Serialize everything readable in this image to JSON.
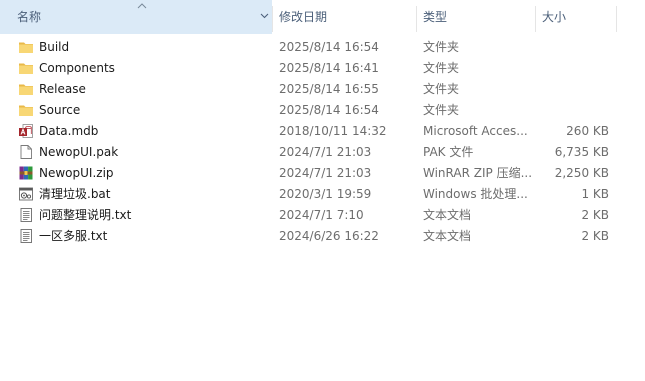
{
  "columns": {
    "name": "名称",
    "date": "修改日期",
    "type": "类型",
    "size": "大小"
  },
  "files": [
    {
      "name": "Build",
      "date": "2025/8/14 16:54",
      "type": "文件夹",
      "size": "",
      "icon": "folder-icon"
    },
    {
      "name": "Components",
      "date": "2025/8/14 16:41",
      "type": "文件夹",
      "size": "",
      "icon": "folder-icon"
    },
    {
      "name": "Release",
      "date": "2025/8/14 16:55",
      "type": "文件夹",
      "size": "",
      "icon": "folder-icon"
    },
    {
      "name": "Source",
      "date": "2025/8/14 16:54",
      "type": "文件夹",
      "size": "",
      "icon": "folder-icon"
    },
    {
      "name": "Data.mdb",
      "date": "2018/10/11 14:32",
      "type": "Microsoft Acces...",
      "size": "260 KB",
      "icon": "access-db-icon"
    },
    {
      "name": "NewopUI.pak",
      "date": "2024/7/1 21:03",
      "type": "PAK 文件",
      "size": "6,735 KB",
      "icon": "blank-file-icon"
    },
    {
      "name": "NewopUI.zip",
      "date": "2024/7/1 21:03",
      "type": "WinRAR ZIP 压缩...",
      "size": "2,250 KB",
      "icon": "winrar-archive-icon"
    },
    {
      "name": "清理垃圾.bat",
      "date": "2020/3/1 19:59",
      "type": "Windows 批处理...",
      "size": "1 KB",
      "icon": "batch-file-icon"
    },
    {
      "name": "问题整理说明.txt",
      "date": "2024/7/1 7:10",
      "type": "文本文档",
      "size": "2 KB",
      "icon": "text-file-icon"
    },
    {
      "name": "一区多服.txt",
      "date": "2024/6/26 16:22",
      "type": "文本文档",
      "size": "2 KB",
      "icon": "text-file-icon"
    }
  ],
  "colors": {
    "folder": "#f8d775",
    "folder_dark": "#e9b949",
    "header_text": "#4c607a",
    "sorted_header_bg": "#dbeaf7",
    "secondary_text": "#6d6d6d"
  }
}
